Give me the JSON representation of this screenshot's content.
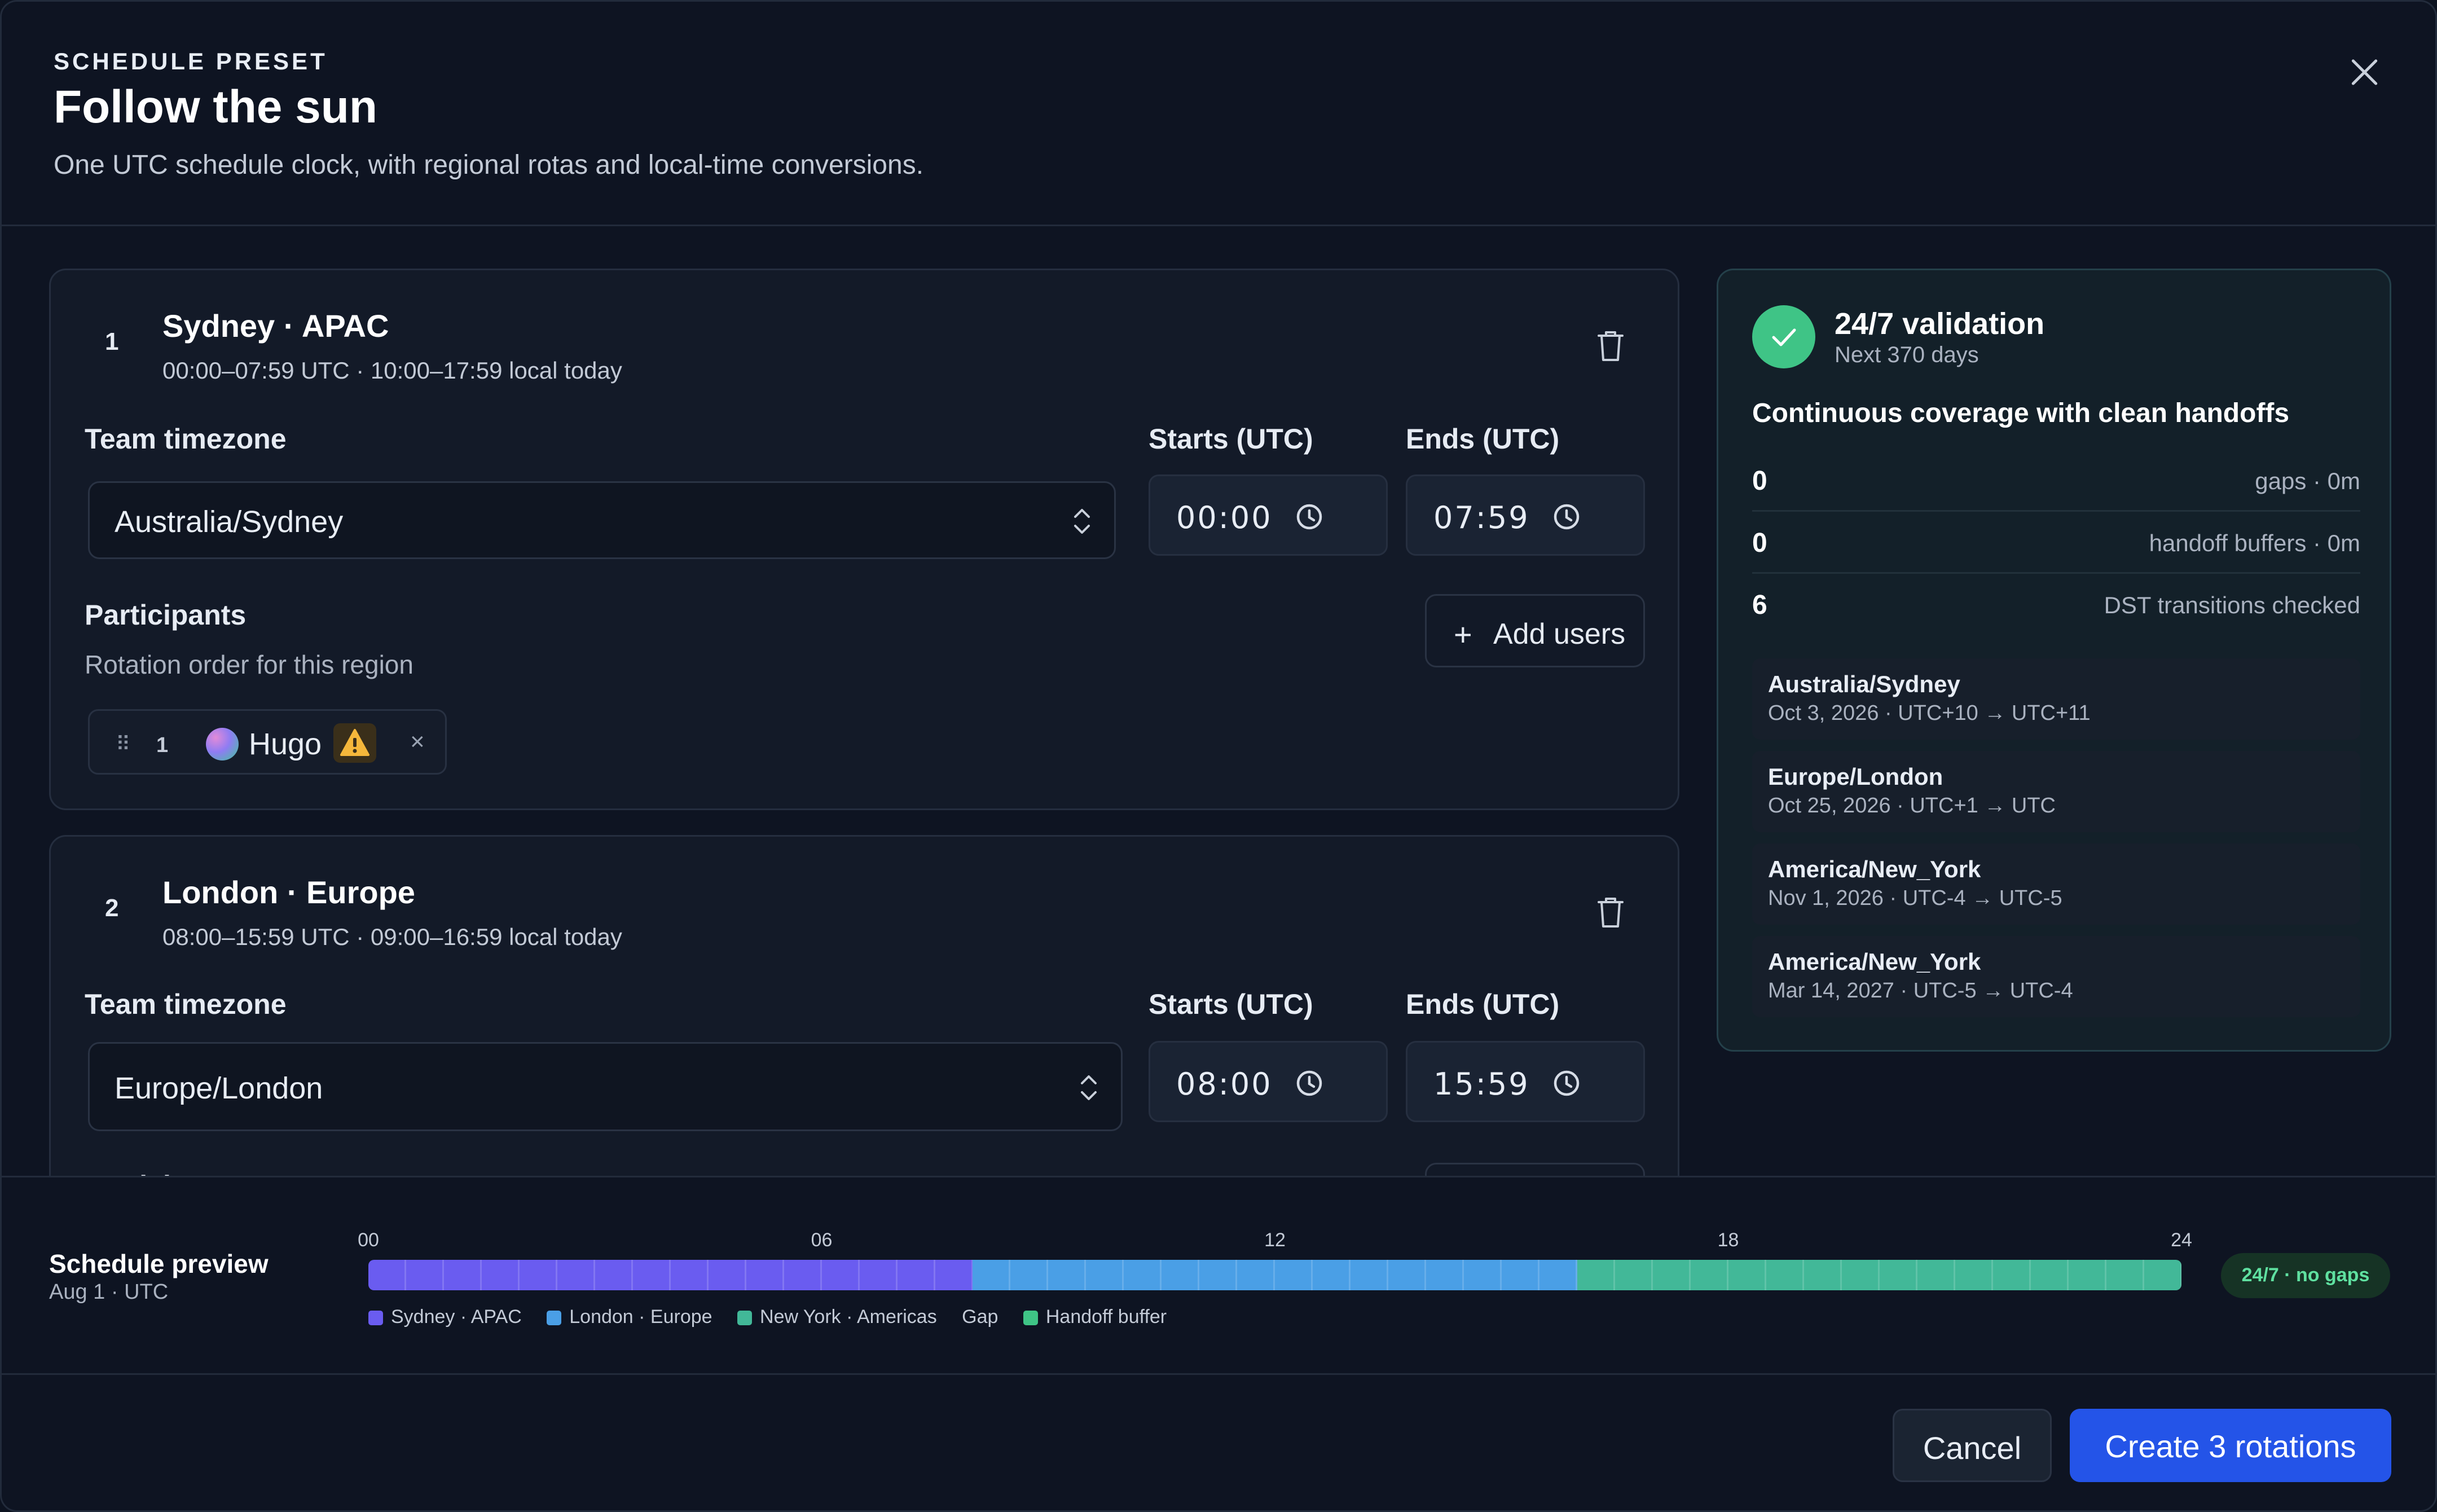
{
  "header": {
    "eyebrow": "SCHEDULE PRESET",
    "title": "Follow the sun",
    "subtitle": "One UTC schedule clock, with regional rotas and local-time conversions.",
    "close_icon": "close-icon"
  },
  "rotations": [
    {
      "order": "1",
      "name": "Sydney · APAC",
      "summary": "00:00–07:59 UTC · 10:00–17:59 local today",
      "timezone_label": "Team timezone",
      "timezone": "Australia/Sydney",
      "starts_label": "Starts (UTC)",
      "starts": "00:00",
      "ends_label": "Ends (UTC)",
      "ends": "07:59",
      "participants_label": "Participants",
      "participants_hint": "Rotation order for this region",
      "add_users": "Add users",
      "participants": [
        {
          "order": "1",
          "name": "Hugo",
          "remove": "×"
        }
      ]
    },
    {
      "order": "2",
      "name": "London · Europe",
      "summary": "08:00–15:59 UTC · 09:00–16:59 local today",
      "timezone_label": "Team timezone",
      "timezone": "Europe/London",
      "starts_label": "Starts (UTC)",
      "starts": "08:00",
      "ends_label": "Ends (UTC)",
      "ends": "15:59",
      "participants_label": "Participants"
    }
  ],
  "validation": {
    "title": "24/7 validation",
    "subtitle": "Next 370 days",
    "headline": "Continuous coverage with clean handoffs",
    "stats": [
      {
        "value": "0",
        "label": "gaps · 0m"
      },
      {
        "value": "0",
        "label": "handoff buffers · 0m"
      },
      {
        "value": "6",
        "label": "DST transitions checked"
      }
    ],
    "transitions": [
      {
        "zone": "Australia/Sydney",
        "detail": "Oct 3, 2026 · UTC+10 → UTC+11"
      },
      {
        "zone": "Europe/London",
        "detail": "Oct 25, 2026 · UTC+1 → UTC"
      },
      {
        "zone": "America/New_York",
        "detail": "Nov 1, 2026 · UTC-4 → UTC-5"
      },
      {
        "zone": "America/New_York",
        "detail": "Mar 14, 2027 · UTC-5 → UTC-4"
      }
    ]
  },
  "preview": {
    "title": "Schedule preview",
    "subtitle": "Aug 1 · UTC",
    "ticks": [
      "00",
      "06",
      "12",
      "18",
      "24"
    ],
    "hours_total": 24,
    "segments": [
      {
        "start": 0,
        "end": 8,
        "color": "#6a5cf0"
      },
      {
        "start": 8,
        "end": 16,
        "color": "#4a9fe6"
      },
      {
        "start": 16,
        "end": 24,
        "color": "#42b898"
      }
    ],
    "legend": [
      {
        "label": "Sydney · APAC",
        "color": "#6a5cf0"
      },
      {
        "label": "London · Europe",
        "color": "#4a9fe6"
      },
      {
        "label": "New York · Americas",
        "color": "#42b898"
      },
      {
        "label": "Gap",
        "color": ""
      },
      {
        "label": "Handoff buffer",
        "color": "#3fc486"
      }
    ],
    "badge": "24/7 · no gaps"
  },
  "footer": {
    "cancel": "Cancel",
    "create": "Create 3 rotations"
  },
  "colors": {
    "accent": "#2454e8",
    "success": "#3fc486",
    "warning": "#f5b73b"
  }
}
